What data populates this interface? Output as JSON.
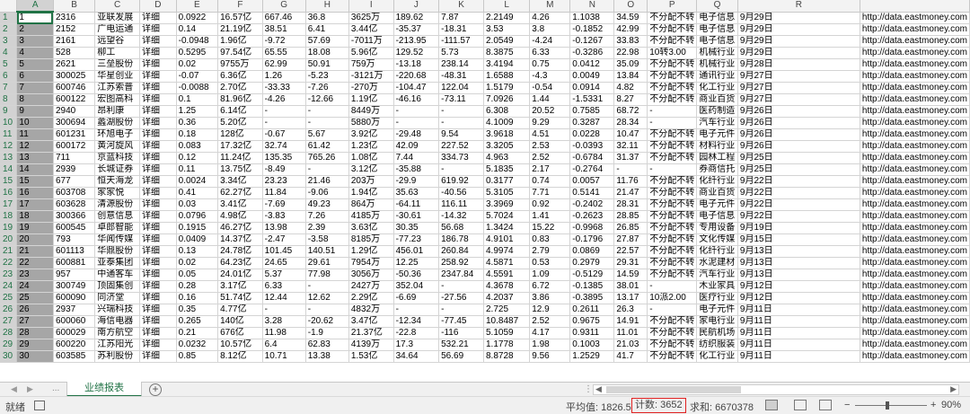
{
  "columns": [
    "A",
    "B",
    "C",
    "D",
    "E",
    "F",
    "G",
    "H",
    "I",
    "J",
    "K",
    "L",
    "M",
    "N",
    "O",
    "P",
    "Q",
    "R"
  ],
  "rows": [
    [
      "1",
      "2316",
      "亚联发展",
      "详细",
      "0.0922",
      "16.57亿",
      "667.46",
      "36.8",
      "3625万",
      "189.62",
      "7.87",
      "2.2149",
      "4.26",
      "1.1038",
      "34.59",
      "不分配不转",
      "电子信息",
      "9月29日",
      "http://data.eastmoney.com"
    ],
    [
      "2",
      "2152",
      "广电运通",
      "详细",
      "0.14",
      "21.19亿",
      "38.51",
      "6.41",
      "3.44亿",
      "-35.37",
      "-18.31",
      "3.53",
      "3.8",
      "-0.1852",
      "42.99",
      "不分配不转",
      "电子信息",
      "9月29日",
      "http://data.eastmoney.com"
    ],
    [
      "3",
      "2161",
      "远望谷",
      "详细",
      "-0.0948",
      "1.96亿",
      "-9.72",
      "57.69",
      "-7011万",
      "-213.95",
      "-111.57",
      "2.0549",
      "-4.24",
      "-0.1267",
      "33.83",
      "不分配不转",
      "电子信息",
      "9月29日",
      "http://data.eastmoney.com"
    ],
    [
      "4",
      "528",
      "柳工",
      "详细",
      "0.5295",
      "97.54亿",
      "65.55",
      "18.08",
      "5.96亿",
      "129.52",
      "5.73",
      "8.3875",
      "6.33",
      "-0.3286",
      "22.98",
      "10转3.00",
      "机械行业",
      "9月29日",
      "http://data.eastmoney.com"
    ],
    [
      "5",
      "2621",
      "三垒股份",
      "详细",
      "0.02",
      "9755万",
      "62.99",
      "50.91",
      "759万",
      "-13.18",
      "238.14",
      "3.4194",
      "0.75",
      "0.0412",
      "35.09",
      "不分配不转",
      "机械行业",
      "9月28日",
      "http://data.eastmoney.com"
    ],
    [
      "6",
      "300025",
      "华星创业",
      "详细",
      "-0.07",
      "6.36亿",
      "1.26",
      "-5.23",
      "-3121万",
      "-220.68",
      "-48.31",
      "1.6588",
      "-4.3",
      "0.0049",
      "13.84",
      "不分配不转",
      "通讯行业",
      "9月27日",
      "http://data.eastmoney.com"
    ],
    [
      "7",
      "600746",
      "江苏索普",
      "详细",
      "-0.0088",
      "2.70亿",
      "-33.33",
      "-7.26",
      "-270万",
      "-104.47",
      "122.04",
      "1.5179",
      "-0.54",
      "0.0914",
      "4.82",
      "不分配不转",
      "化工行业",
      "9月27日",
      "http://data.eastmoney.com"
    ],
    [
      "8",
      "600122",
      "宏图高科",
      "详细",
      "0.1",
      "81.96亿",
      "-4.26",
      "-12.66",
      "1.19亿",
      "-46.16",
      "-73.11",
      "7.0926",
      "1.44",
      "-1.5331",
      "8.27",
      "不分配不转",
      "商业百货",
      "9月27日",
      "http://data.eastmoney.com"
    ],
    [
      "9",
      "2940",
      "昂利康",
      "详细",
      "1.25",
      "6.14亿",
      "-",
      "-",
      "8449万",
      "-",
      "-",
      "6.308",
      "20.52",
      "0.7585",
      "68.72",
      "-",
      "医药制造",
      "9月26日",
      "http://data.eastmoney.com"
    ],
    [
      "10",
      "300694",
      "蠡湖股份",
      "详细",
      "0.36",
      "5.20亿",
      "-",
      "-",
      "5880万",
      "-",
      "-",
      "4.1009",
      "9.29",
      "0.3287",
      "28.34",
      "-",
      "汽车行业",
      "9月26日",
      "http://data.eastmoney.com"
    ],
    [
      "11",
      "601231",
      "环旭电子",
      "详细",
      "0.18",
      "128亿",
      "-0.67",
      "5.67",
      "3.92亿",
      "-29.48",
      "9.54",
      "3.9618",
      "4.51",
      "0.0228",
      "10.47",
      "不分配不转",
      "电子元件",
      "9月26日",
      "http://data.eastmoney.com"
    ],
    [
      "12",
      "600172",
      "黄河旋风",
      "详细",
      "0.083",
      "17.32亿",
      "32.74",
      "61.42",
      "1.23亿",
      "42.09",
      "227.52",
      "3.3205",
      "2.53",
      "-0.0393",
      "32.11",
      "不分配不转",
      "材料行业",
      "9月26日",
      "http://data.eastmoney.com"
    ],
    [
      "13",
      "711",
      "京蓝科技",
      "详细",
      "0.12",
      "11.24亿",
      "135.35",
      "765.26",
      "1.08亿",
      "7.44",
      "334.73",
      "4.963",
      "2.52",
      "-0.6784",
      "31.37",
      "不分配不转",
      "园林工程",
      "9月25日",
      "http://data.eastmoney.com"
    ],
    [
      "14",
      "2939",
      "长城证券",
      "详细",
      "0.11",
      "13.75亿",
      "-8.49",
      "-",
      "3.12亿",
      "-35.88",
      "-",
      "5.1835",
      "2.17",
      "-0.2764",
      "-",
      "-",
      "券商信托",
      "9月25日",
      "http://data.eastmoney.com"
    ],
    [
      "15",
      "677",
      "恒天海龙",
      "详细",
      "0.0024",
      "3.34亿",
      "23.23",
      "21.46",
      "203万",
      "-29.9",
      "619.92",
      "0.3177",
      "0.74",
      "0.0057",
      "11.76",
      "不分配不转",
      "化纤行业",
      "9月22日",
      "http://data.eastmoney.com"
    ],
    [
      "16",
      "603708",
      "家家悦",
      "详细",
      "0.41",
      "62.27亿",
      "11.84",
      "-9.06",
      "1.94亿",
      "35.63",
      "-40.56",
      "5.3105",
      "7.71",
      "0.5141",
      "21.47",
      "不分配不转",
      "商业百货",
      "9月22日",
      "http://data.eastmoney.com"
    ],
    [
      "17",
      "603628",
      "清源股份",
      "详细",
      "0.03",
      "3.41亿",
      "-7.69",
      "49.23",
      "864万",
      "-64.11",
      "116.11",
      "3.3969",
      "0.92",
      "-0.2402",
      "28.31",
      "不分配不转",
      "电子元件",
      "9月22日",
      "http://data.eastmoney.com"
    ],
    [
      "18",
      "300366",
      "创意信息",
      "详细",
      "0.0796",
      "4.98亿",
      "-3.83",
      "7.26",
      "4185万",
      "-30.61",
      "-14.32",
      "5.7024",
      "1.41",
      "-0.2623",
      "28.85",
      "不分配不转",
      "电子信息",
      "9月22日",
      "http://data.eastmoney.com"
    ],
    [
      "19",
      "600545",
      "卓郎智能",
      "详细",
      "0.1915",
      "46.27亿",
      "13.98",
      "2.39",
      "3.63亿",
      "30.35",
      "56.68",
      "1.3424",
      "15.22",
      "-0.9968",
      "26.85",
      "不分配不转",
      "专用设备",
      "9月19日",
      "http://data.eastmoney.com"
    ],
    [
      "20",
      "793",
      "华闻传媒",
      "详细",
      "0.0409",
      "14.37亿",
      "-2.47",
      "-3.58",
      "8185万",
      "-77.23",
      "186.78",
      "4.9101",
      "0.83",
      "-0.1796",
      "27.87",
      "不分配不转",
      "文化传媒",
      "9月15日",
      "http://data.eastmoney.com"
    ],
    [
      "21",
      "601113",
      "华鼎股份",
      "详细",
      "0.13",
      "24.78亿",
      "101.45",
      "140.51",
      "1.29亿",
      "456.01",
      "260.84",
      "4.9974",
      "2.79",
      "0.0869",
      "22.57",
      "不分配不转",
      "化纤行业",
      "9月13日",
      "http://data.eastmoney.com"
    ],
    [
      "22",
      "600881",
      "亚泰集团",
      "详细",
      "0.02",
      "64.23亿",
      "24.65",
      "29.61",
      "7954万",
      "12.25",
      "258.92",
      "4.5871",
      "0.53",
      "0.2979",
      "29.31",
      "不分配不转",
      "水泥建材",
      "9月13日",
      "http://data.eastmoney.com"
    ],
    [
      "23",
      "957",
      "中通客车",
      "详细",
      "0.05",
      "24.01亿",
      "5.37",
      "77.98",
      "3056万",
      "-50.36",
      "2347.84",
      "4.5591",
      "1.09",
      "-0.5129",
      "14.59",
      "不分配不转",
      "汽车行业",
      "9月13日",
      "http://data.eastmoney.com"
    ],
    [
      "24",
      "300749",
      "顶固集创",
      "详细",
      "0.28",
      "3.17亿",
      "6.33",
      "-",
      "2427万",
      "352.04",
      "-",
      "4.3678",
      "6.72",
      "-0.1385",
      "38.01",
      "-",
      "木业家具",
      "9月12日",
      "http://data.eastmoney.com"
    ],
    [
      "25",
      "600090",
      "同济堂",
      "详细",
      "0.16",
      "51.74亿",
      "12.44",
      "12.62",
      "2.29亿",
      "-6.69",
      "-27.56",
      "4.2037",
      "3.86",
      "-0.3895",
      "13.17",
      "10派2.00",
      "医疗行业",
      "9月12日",
      "http://data.eastmoney.com"
    ],
    [
      "26",
      "2937",
      "兴瑞科技",
      "详细",
      "0.35",
      "4.77亿",
      "-",
      "-",
      "4832万",
      "-",
      "-",
      "2.725",
      "12.9",
      "0.2611",
      "26.3",
      "-",
      "电子元件",
      "9月11日",
      "http://data.eastmoney.com"
    ],
    [
      "27",
      "600060",
      "海信电器",
      "详细",
      "0.265",
      "140亿",
      "3.28",
      "-20.62",
      "3.47亿",
      "-12.34",
      "-77.45",
      "10.8487",
      "2.52",
      "0.9675",
      "14.91",
      "不分配不转",
      "家电行业",
      "9月11日",
      "http://data.eastmoney.com"
    ],
    [
      "28",
      "600029",
      "南方航空",
      "详细",
      "0.21",
      "676亿",
      "11.98",
      "-1.9",
      "21.37亿",
      "-22.8",
      "-116",
      "5.1059",
      "4.17",
      "0.9311",
      "11.01",
      "不分配不转",
      "民航机场",
      "9月11日",
      "http://data.eastmoney.com"
    ],
    [
      "29",
      "600220",
      "江苏阳光",
      "详细",
      "0.0232",
      "10.57亿",
      "6.4",
      "62.83",
      "4139万",
      "17.3",
      "532.21",
      "1.1778",
      "1.98",
      "0.1003",
      "21.03",
      "不分配不转",
      "纺织服装",
      "9月11日",
      "http://data.eastmoney.com"
    ],
    [
      "30",
      "603585",
      "苏利股份",
      "详细",
      "0.85",
      "8.12亿",
      "10.71",
      "13.38",
      "1.53亿",
      "34.64",
      "56.69",
      "8.8728",
      "9.56",
      "1.2529",
      "41.7",
      "不分配不转",
      "化工行业",
      "9月11日",
      "http://data.eastmoney.com"
    ]
  ],
  "sheet_tab": "业绩报表",
  "add_sheet": "+",
  "tab_dots": "...",
  "status": {
    "ready": "就绪",
    "average": "平均值: 1826.5",
    "count": "计数: 3652",
    "sum": "求和: 6670378",
    "zoom_minus": "−",
    "zoom_plus": "+",
    "zoom": "90%"
  },
  "colors": {
    "accent": "#217346",
    "highlight": "#e02020",
    "selection": "#a6a6a6"
  },
  "icons": [
    "sheet-prev-icon",
    "sheet-next-icon",
    "add-sheet-icon",
    "macro-record-icon",
    "normal-view-icon",
    "page-layout-icon",
    "page-break-icon"
  ]
}
